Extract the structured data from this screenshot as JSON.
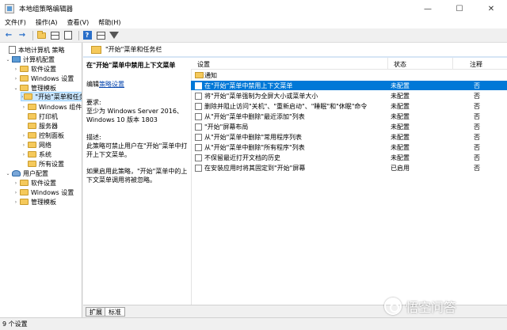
{
  "window": {
    "title": "本地组策略编辑器",
    "controls": {
      "minimize": "—",
      "maximize": "☐",
      "close": "✕"
    }
  },
  "menubar": [
    {
      "label": "文件(F)"
    },
    {
      "label": "操作(A)"
    },
    {
      "label": "查看(V)"
    },
    {
      "label": "帮助(H)"
    }
  ],
  "toolbar": {
    "icons": [
      "back-arrow-icon",
      "forward-arrow-icon",
      "up-folder-icon",
      "show-hide-tree-icon",
      "export-list-icon",
      "help-icon",
      "properties-icon",
      "filter-icon"
    ]
  },
  "tree": [
    {
      "label": "本地计算机 策略",
      "icon": "doc",
      "indent": 0,
      "twisty": ""
    },
    {
      "label": "计算机配置",
      "icon": "computer",
      "indent": 1,
      "twisty": "⌄"
    },
    {
      "label": "软件设置",
      "icon": "folder",
      "indent": 2,
      "twisty": "›"
    },
    {
      "label": "Windows 设置",
      "icon": "folder",
      "indent": 2,
      "twisty": "›"
    },
    {
      "label": "管理模板",
      "icon": "folder",
      "indent": 2,
      "twisty": "⌄"
    },
    {
      "label": "\"开始\"菜单和任务栏",
      "icon": "folder",
      "indent": 3,
      "twisty": "›",
      "selected": true
    },
    {
      "label": "Windows 组件",
      "icon": "folder",
      "indent": 3,
      "twisty": "›"
    },
    {
      "label": "打印机",
      "icon": "folder",
      "indent": 3,
      "twisty": ""
    },
    {
      "label": "服务器",
      "icon": "folder",
      "indent": 3,
      "twisty": ""
    },
    {
      "label": "控制面板",
      "icon": "folder",
      "indent": 3,
      "twisty": "›"
    },
    {
      "label": "网络",
      "icon": "folder",
      "indent": 3,
      "twisty": "›"
    },
    {
      "label": "系统",
      "icon": "folder",
      "indent": 3,
      "twisty": "›"
    },
    {
      "label": "所有设置",
      "icon": "folder",
      "indent": 3,
      "twisty": ""
    },
    {
      "label": "用户配置",
      "icon": "user",
      "indent": 1,
      "twisty": "⌄"
    },
    {
      "label": "软件设置",
      "icon": "folder",
      "indent": 2,
      "twisty": "›"
    },
    {
      "label": "Windows 设置",
      "icon": "folder",
      "indent": 2,
      "twisty": "›"
    },
    {
      "label": "管理模板",
      "icon": "folder",
      "indent": 2,
      "twisty": "›"
    }
  ],
  "header": {
    "title": "\"开始\"菜单和任务栏"
  },
  "description": {
    "title": "在\"开始\"菜单中禁用上下文菜单",
    "edit_prefix": "编辑",
    "edit_link": "策略设置",
    "requirements_label": "要求:",
    "requirements": "至少为 Windows Server 2016、Windows 10 版本 1803",
    "desc_label": "描述:",
    "desc_text": "此策略可禁止用户在\"开始\"菜单中打开上下文菜单。",
    "desc_text2": "如果启用此策略，\"开始\"菜单中的上下文菜单调用将被忽略。"
  },
  "list": {
    "columns": {
      "setting": "设置",
      "state": "状态",
      "note": "注释"
    },
    "rows": [
      {
        "name": "通知",
        "state": "",
        "note": "",
        "type": "folder"
      },
      {
        "name": "在\"开始\"菜单中禁用上下文菜单",
        "state": "未配置",
        "note": "否",
        "type": "setting",
        "selected": true
      },
      {
        "name": "将\"开始\"菜单强制为全屏大小或菜单大小",
        "state": "未配置",
        "note": "否",
        "type": "setting"
      },
      {
        "name": "删除并阻止访问\"关机\"、\"重新启动\"、\"睡眠\"和\"休眠\"命令",
        "state": "未配置",
        "note": "否",
        "type": "setting"
      },
      {
        "name": "从\"开始\"菜单中删除\"最近添加\"列表",
        "state": "未配置",
        "note": "否",
        "type": "setting"
      },
      {
        "name": "\"开始\"屏幕布局",
        "state": "未配置",
        "note": "否",
        "type": "setting"
      },
      {
        "name": "从\"开始\"菜单中删除\"常用程序列表",
        "state": "未配置",
        "note": "否",
        "type": "setting"
      },
      {
        "name": "从\"开始\"菜单中删除\"所有程序\"列表",
        "state": "未配置",
        "note": "否",
        "type": "setting"
      },
      {
        "name": "不保留最近打开文档的历史",
        "state": "未配置",
        "note": "否",
        "type": "setting"
      },
      {
        "name": "在安装应用时将其固定到\"开始\"屏幕",
        "state": "已启用",
        "note": "否",
        "type": "setting"
      }
    ]
  },
  "tabs": [
    {
      "label": "扩展",
      "active": false
    },
    {
      "label": "标准",
      "active": true
    }
  ],
  "status": {
    "text": "9 个设置"
  },
  "watermark": {
    "text": "悟空问答"
  }
}
